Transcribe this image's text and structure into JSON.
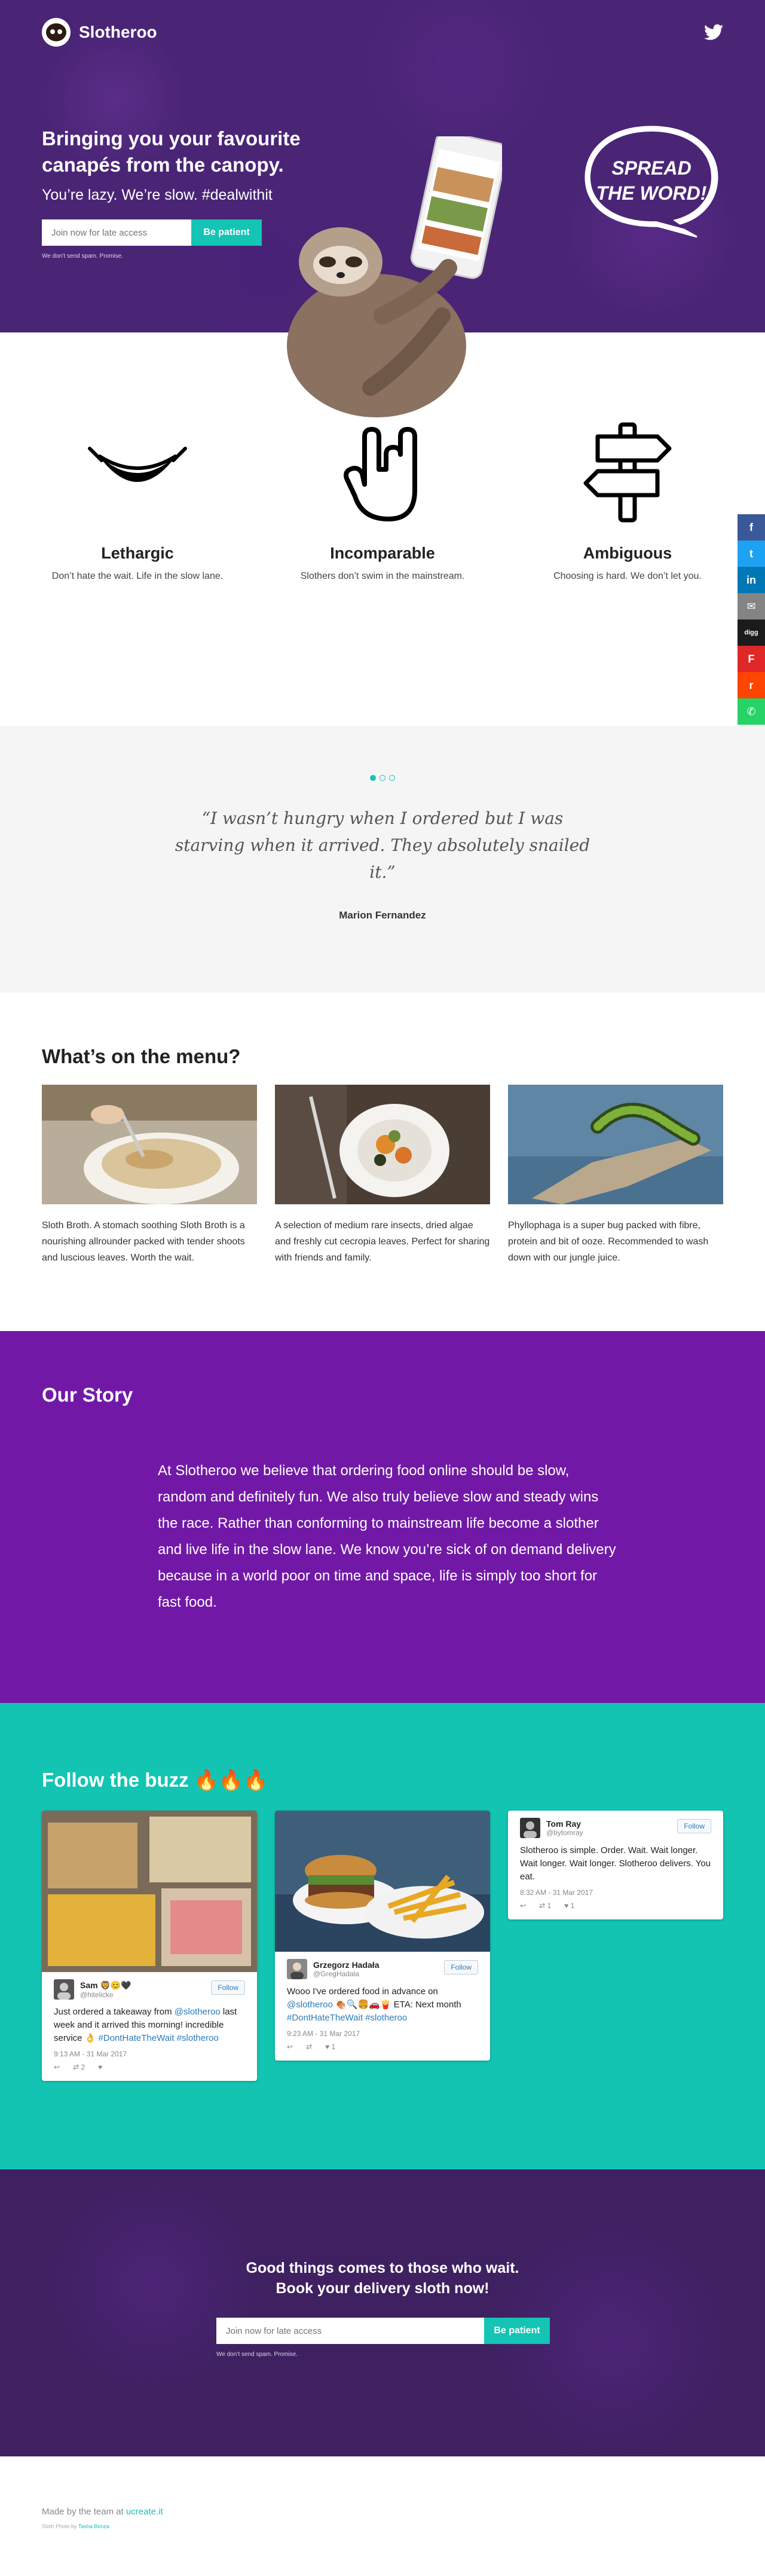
{
  "brand": {
    "name": "Slotheroo",
    "logo_icon": "sloth-face-icon"
  },
  "nav": {
    "social_icon": "twitter-icon"
  },
  "hero": {
    "title": "Bringing you your favourite canapés from the canopy.",
    "subtitle": "You’re lazy. We’re slow. #dealwithit",
    "input_placeholder": "Join now for late access",
    "button_label": "Be patient",
    "no_spam": "We don’t send spam. Promise.",
    "badge_line1": "SPREAD",
    "badge_line2": "THE WORD!"
  },
  "features": [
    {
      "icon": "hammock-icon",
      "title": "Lethargic",
      "text": "Don’t hate the wait. Life in the slow lane."
    },
    {
      "icon": "rock-hand-icon",
      "title": "Incomparable",
      "text": "Slothers don’t swim in the mainstream."
    },
    {
      "icon": "signpost-icon",
      "title": "Ambiguous",
      "text": "Choosing is hard. We don’t let you."
    }
  ],
  "testimonial": {
    "quote": "“I wasn’t hungry when I ordered but I was starving when it arrived. They absolutely snailed it.”",
    "author": "Marion Fernandez",
    "active_slide": 1,
    "slide_count": 3
  },
  "menu": {
    "title": "What’s on the menu?",
    "items": [
      {
        "text": "Sloth Broth. A stomach soothing Sloth Broth is a nourishing allrounder packed with tender shoots and luscious leaves. Worth the wait."
      },
      {
        "text": "A selection of medium rare insects, dried algae and freshly cut cecropia leaves. Perfect for sharing with friends and family."
      },
      {
        "text": "Phyllophaga is a super bug packed with fibre, protein and bit of ooze. Recommended to wash down with our jungle juice."
      }
    ]
  },
  "story": {
    "title": "Our Story",
    "text": "At Slotheroo we believe that ordering food online should be slow, random and definitely fun. We also truly believe slow and steady wins the race. Rather than conforming to mainstream life become a slother and live life in the slow lane. We know you’re sick of on demand delivery because in a world poor on time and space, life is simply too short for fast food."
  },
  "buzz": {
    "title": "Follow the buzz 🔥🔥🔥",
    "follow_label": "Follow",
    "tweets": [
      {
        "name": "Sam 🦁😊🖤",
        "handle": "@hitelicke",
        "text_pre": "Just ordered a takeaway from ",
        "mention": "@slotheroo",
        "text_mid": " last week and it arrived this morning! incredible service 👌 ",
        "hashtags": "#DontHateTheWait #slotheroo",
        "date": "9:13 AM - 31 Mar 2017",
        "retweets": "2",
        "likes": ""
      },
      {
        "name": "Grzegorz Hadała",
        "handle": "@GregHadala",
        "text_pre": "Wooo I've ordered food in advance on ",
        "mention": "@slotheroo",
        "text_mid": " 🍖🔍🍔🚗🍟 ETA: Next month ",
        "hashtags": "#DontHateTheWait #slotheroo",
        "date": "9:23 AM - 31 Mar 2017",
        "retweets": "",
        "likes": "1"
      },
      {
        "name": "Tom Ray",
        "handle": "@bytomray",
        "text_pre": "Slotheroo is simple. Order. Wait. Wait longer. Wait longer. Wait longer. Slotheroo delivers. You eat.",
        "mention": "",
        "text_mid": "",
        "hashtags": "",
        "date": "8:32 AM - 31 Mar 2017",
        "retweets": "1",
        "likes": "1"
      }
    ]
  },
  "cta": {
    "title_line1": "Good things comes to those who wait.",
    "title_line2": "Book your delivery sloth now!",
    "input_placeholder": "Join now for late access",
    "button_label": "Be patient",
    "no_spam": "We don’t send spam. Promise."
  },
  "footer": {
    "made_prefix": "Made by the team at ",
    "made_link": "ucreate.it",
    "credit_prefix": "Sloth Photo by ",
    "credit_link": "Tasha Bonza"
  },
  "share": [
    {
      "icon": "facebook-icon",
      "glyph": "f",
      "color": "#3b5998"
    },
    {
      "icon": "twitter-icon",
      "glyph": "t",
      "color": "#1da1f2"
    },
    {
      "icon": "linkedin-icon",
      "glyph": "in",
      "color": "#0077b5"
    },
    {
      "icon": "email-icon",
      "glyph": "✉",
      "color": "#848484"
    },
    {
      "icon": "digg-icon",
      "glyph": "digg",
      "color": "#1b1b1b"
    },
    {
      "icon": "flipboard-icon",
      "glyph": "F",
      "color": "#e12828"
    },
    {
      "icon": "reddit-icon",
      "glyph": "r",
      "color": "#ff4500"
    },
    {
      "icon": "whatsapp-icon",
      "glyph": "✆",
      "color": "#25d366"
    }
  ],
  "colors": {
    "accent": "#14c4b4",
    "hero_bg": "#4a2576",
    "story_bg": "#7119a6",
    "buzz_bg": "#13c4b3"
  }
}
